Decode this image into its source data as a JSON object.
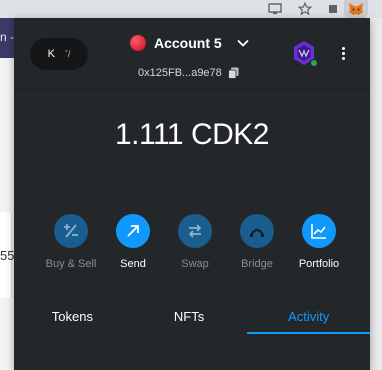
{
  "background": {
    "left_fragment_top": "n -",
    "left_fragment_mid": "55"
  },
  "header": {
    "network_label": "K",
    "network_chevron": "ˇ/",
    "account_name": "Account 5",
    "address": "0x125FB...a9e78",
    "icons": [
      "chevron-down-icon",
      "copy-icon",
      "site-connection-icon",
      "more-vertical-icon"
    ]
  },
  "balance": {
    "text": "1.111 CDK2"
  },
  "actions": [
    {
      "label": "Buy & Sell",
      "icon": "buy-sell-icon",
      "enabled": false
    },
    {
      "label": "Send",
      "icon": "send-arrow-icon",
      "enabled": true
    },
    {
      "label": "Swap",
      "icon": "swap-icon",
      "enabled": false
    },
    {
      "label": "Bridge",
      "icon": "bridge-icon",
      "enabled": false
    },
    {
      "label": "Portfolio",
      "icon": "portfolio-chart-icon",
      "enabled": true
    }
  ],
  "tabs": [
    {
      "label": "Tokens",
      "active": false
    },
    {
      "label": "NFTs",
      "active": false
    },
    {
      "label": "Activity",
      "active": true
    }
  ],
  "colors": {
    "popup_bg": "#24272a",
    "accent": "#1098fc",
    "disabled_circle": "#1a5d8f",
    "disabled_text": "#8a8d91"
  }
}
